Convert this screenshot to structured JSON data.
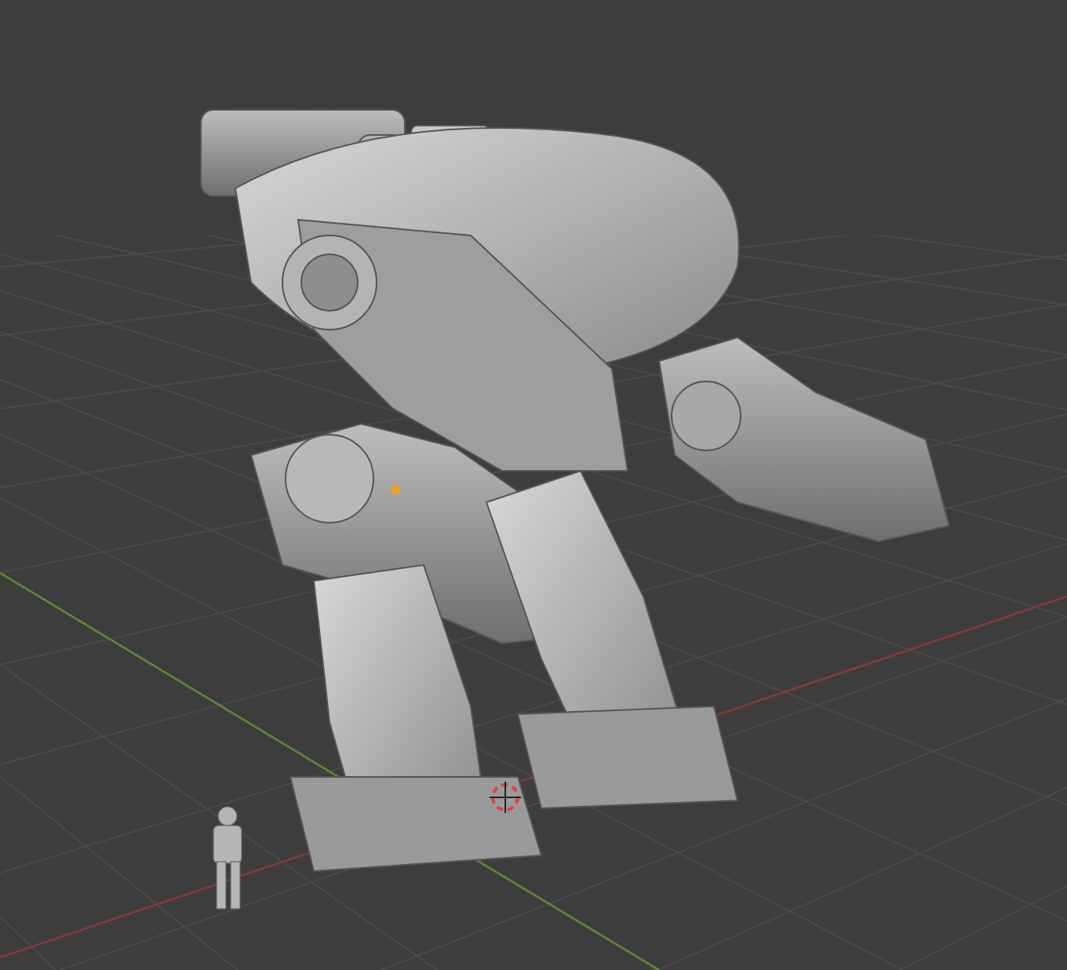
{
  "viewport": {
    "show_grid": true,
    "show_axes": true,
    "show_cursor": true,
    "show_origin": true
  }
}
